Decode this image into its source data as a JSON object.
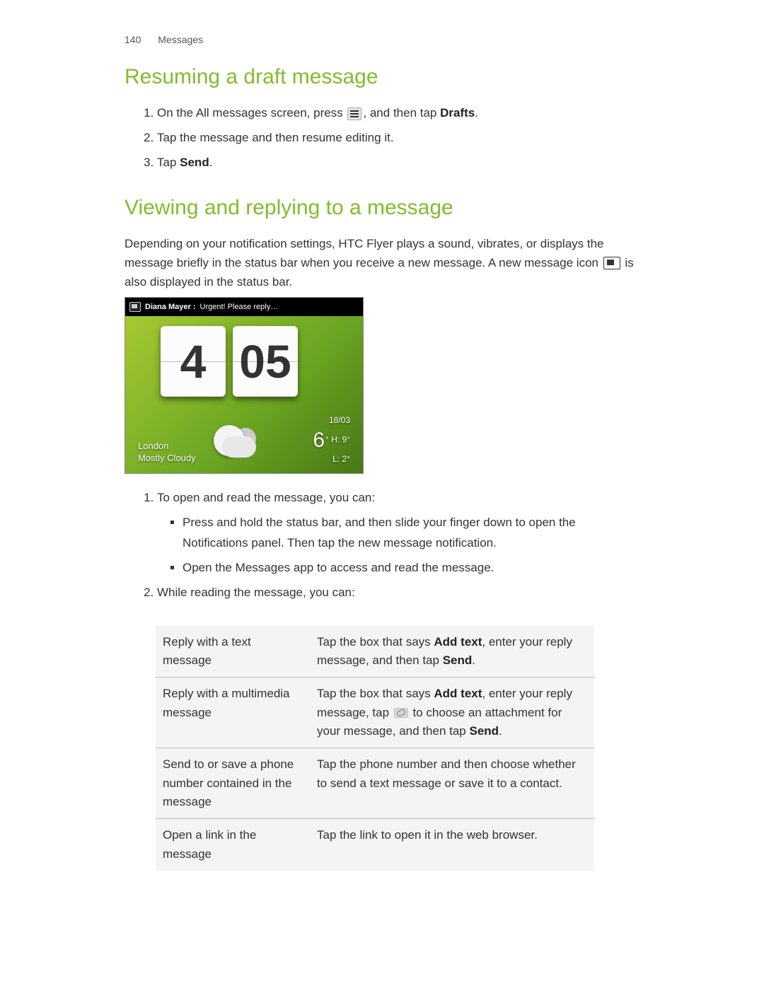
{
  "header": {
    "page_num": "140",
    "section": "Messages"
  },
  "s1": {
    "title": "Resuming a draft message",
    "step1a": "On the All messages screen, press ",
    "step1b": ", and then tap ",
    "step1_bold": "Drafts",
    "step1c": ".",
    "step2": "Tap the message and then resume editing it.",
    "step3a": "Tap ",
    "step3_bold": "Send",
    "step3b": "."
  },
  "s2": {
    "title": "Viewing and replying to a message",
    "intro_a": "Depending on your notification settings, HTC Flyer plays a sound, vibrates, or displays the message briefly in the status bar when you receive a new message. A new message icon ",
    "intro_b": " is also displayed in the status bar.",
    "widget": {
      "sender": "Diana Mayer :",
      "subject": "Urgent! Please reply…",
      "hour": "4",
      "minute": "05",
      "city": "London",
      "cond": "Mostly Cloudy",
      "date": "18/03",
      "tempmain": "6",
      "hi": "H: 9°",
      "lo": "L: 2°"
    },
    "li1": "To open and read the message, you can:",
    "li1b1": "Press and hold the status bar, and then slide your finger down to open the Notifications panel. Then tap the new message notification.",
    "li1b2": "Open the Messages app to access and read the message.",
    "li2": "While reading the message, you can:",
    "table": {
      "r1l": "Reply with a text message",
      "r1a": "Tap the box that says ",
      "r1b": "Add text",
      "r1c": ", enter your reply message, and then tap ",
      "r1d": "Send",
      "r1e": ".",
      "r2l": "Reply with a multimedia message",
      "r2a": "Tap the box that says ",
      "r2b": "Add text",
      "r2c": ", enter your reply message, tap ",
      "r2d": " to choose an attachment for your message, and then tap ",
      "r2e": "Send",
      "r2f": ".",
      "r3l": "Send to or save a phone number contained in the message",
      "r3r": "Tap the phone number and then choose whether to send a text message or save it to a contact.",
      "r4l": "Open a link in the message",
      "r4r": "Tap the link to open it in the web browser."
    }
  }
}
